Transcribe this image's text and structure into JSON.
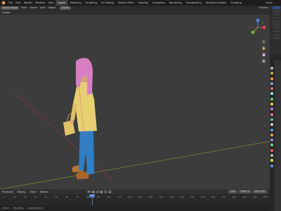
{
  "app": {
    "name": "Blender"
  },
  "topbar": {
    "menus": [
      "File",
      "Edit",
      "Render",
      "Window",
      "Help"
    ],
    "workspaces": [
      "Layout",
      "Modeling",
      "Sculpting",
      "UV Editing",
      "Texture Paint",
      "Shading",
      "Animation",
      "Rendering",
      "Compositing",
      "Geometry Nodes",
      "Scripting"
    ],
    "active_workspace": "Layout",
    "scene_label": "Scene"
  },
  "toolbar": {
    "mode": "Object Mode",
    "items": [
      "View",
      "Select",
      "Add",
      "Object"
    ],
    "orientation": "Global",
    "options_label": "Options"
  },
  "toolbar2": {
    "label": "Global"
  },
  "viewport": {
    "accent_colors": {
      "hair": "#d77fc2",
      "sweater": "#e8cf72",
      "pants": "#2e7fc5",
      "shoes": "#b8742f",
      "skin": "#d7a47a",
      "x_axis": "#8a3a4a",
      "y_axis": "#7a8a2a"
    }
  },
  "gizmo": {
    "x": "X",
    "y": "Y",
    "z": "Z"
  },
  "timeline": {
    "menus": [
      "Playback",
      "Keying",
      "View",
      "Marker"
    ],
    "current_frame": "120",
    "start_label": "Start",
    "start": "1",
    "end_label": "End",
    "end": "250",
    "ruler": [
      "0",
      "10",
      "20",
      "30",
      "40",
      "50",
      "60",
      "70",
      "80",
      "90",
      "100",
      "110",
      "120",
      "130",
      "140",
      "150",
      "160",
      "170",
      "180",
      "190",
      "200",
      "210",
      "220",
      "230",
      "240",
      "250"
    ]
  },
  "statusbar": {
    "left": "Select",
    "middle": "Pan View",
    "right": "Context Menu"
  },
  "properties_tabs": [
    "#b0b0b0",
    "#c8a040",
    "#e08a4a",
    "#6aa0d8",
    "#d86a5a",
    "#8ad0d8",
    "#6ac06a",
    "#d8c85a",
    "#a07ad8",
    "#e06a8a",
    "#5ab0a0",
    "#c0c0c0",
    "#4a9ad8",
    "#d8a05a",
    "#8a8ad8",
    "#5ad08a",
    "#e05a5a",
    "#b0b0b0",
    "#d8d85a",
    "#5a8ad8"
  ]
}
